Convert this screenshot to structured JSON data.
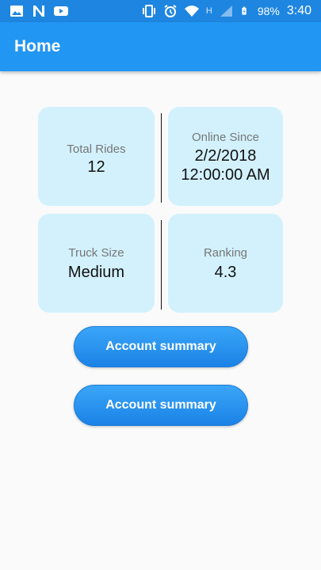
{
  "status_bar": {
    "battery": "98%",
    "time": "3:40",
    "network_letter": "H",
    "left_icons": [
      "image-icon",
      "n-notification-icon",
      "youtube-icon"
    ],
    "right_icons": [
      "vibrate-icon",
      "alarm-icon",
      "wifi-icon",
      "signal-icon",
      "battery-icon"
    ]
  },
  "appbar": {
    "title": "Home"
  },
  "stats": {
    "total_rides": {
      "label": "Total Rides",
      "value": "12"
    },
    "online_since": {
      "label": "Online Since",
      "value_line1": "2/2/2018",
      "value_line2": "12:00:00 AM"
    },
    "truck_size": {
      "label": "Truck Size",
      "value": "Medium"
    },
    "ranking": {
      "label": "Ranking",
      "value": "4.3"
    }
  },
  "buttons": [
    {
      "label": "Account summary"
    },
    {
      "label": "Account summary"
    }
  ],
  "colors": {
    "status_bar": "#1e86e0",
    "app_bar": "#2196f3",
    "card": "#d2f1fd",
    "button": "#2a92ef",
    "background": "#fafafa"
  }
}
